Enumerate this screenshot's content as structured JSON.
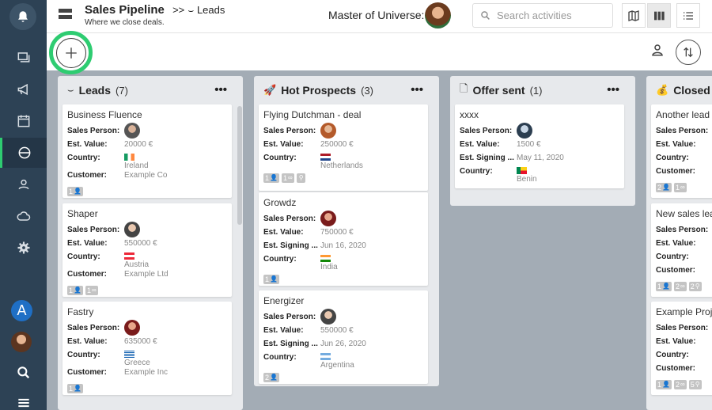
{
  "header": {
    "title": "Sales Pipeline",
    "breadcrumb_sep": ">>",
    "breadcrumb_current": "Leads",
    "subtitle": "Where we close deals.",
    "user_label": "Master of Universe:",
    "search_placeholder": "Search activities"
  },
  "sidebar": {
    "avatar_letter": "A"
  },
  "columns": [
    {
      "name": "Leads",
      "count": "(7)",
      "icon": "handshake-icon",
      "cards": [
        {
          "title": "Business Fluence",
          "rows": [
            {
              "label": "Sales Person:",
              "type": "avatar"
            },
            {
              "label": "Est. Value:",
              "value": "20000 €"
            },
            {
              "label": "Country:",
              "value": "Ireland",
              "flag": "ireland"
            },
            {
              "label": "Customer:",
              "value": "Example Co"
            }
          ],
          "badges": [
            "1"
          ]
        },
        {
          "title": "Shaper",
          "rows": [
            {
              "label": "Sales Person:",
              "type": "avatar"
            },
            {
              "label": "Est. Value:",
              "value": "550000 €"
            },
            {
              "label": "Country:",
              "value": "Austria",
              "flag": "austria"
            },
            {
              "label": "Customer:",
              "value": "Example Ltd"
            }
          ],
          "badges": [
            "1",
            "1"
          ]
        },
        {
          "title": "Fastry",
          "rows": [
            {
              "label": "Sales Person:",
              "type": "avatar"
            },
            {
              "label": "Est. Value:",
              "value": "635000 €"
            },
            {
              "label": "Country:",
              "value": "Greece",
              "flag": "greece"
            },
            {
              "label": "Customer:",
              "value": "Example Inc"
            }
          ],
          "badges": [
            "1"
          ]
        }
      ]
    },
    {
      "name": "Hot Prospects",
      "count": "(3)",
      "icon": "rocket-icon",
      "cards": [
        {
          "title": "Flying Dutchman - deal",
          "rows": [
            {
              "label": "Sales Person:",
              "type": "avatar"
            },
            {
              "label": "Est. Value:",
              "value": "250000 €"
            },
            {
              "label": "Country:",
              "value": "Netherlands",
              "flag": "netherlands"
            }
          ],
          "badges": [
            "1",
            "1",
            ""
          ]
        },
        {
          "title": "Growdz",
          "rows": [
            {
              "label": "Sales Person:",
              "type": "avatar"
            },
            {
              "label": "Est. Value:",
              "value": "750000 €"
            },
            {
              "label": "Est. Signing ...",
              "value": "Jun 16, 2020"
            },
            {
              "label": "Country:",
              "value": "India",
              "flag": "india"
            }
          ],
          "badges": [
            "1"
          ]
        },
        {
          "title": "Energizer",
          "rows": [
            {
              "label": "Sales Person:",
              "type": "avatar"
            },
            {
              "label": "Est. Value:",
              "value": "550000 €"
            },
            {
              "label": "Est. Signing ...",
              "value": "Jun 26, 2020"
            },
            {
              "label": "Country:",
              "value": "Argentina",
              "flag": "argentina"
            }
          ],
          "badges": [
            "2"
          ]
        }
      ]
    },
    {
      "name": "Offer sent",
      "count": "(1)",
      "icon": "document-icon",
      "cards": [
        {
          "title": "xxxx",
          "rows": [
            {
              "label": "Sales Person:",
              "type": "avatar"
            },
            {
              "label": "Est. Value:",
              "value": "1500 €"
            },
            {
              "label": "Est. Signing ...",
              "value": "May 11, 2020"
            },
            {
              "label": "Country:",
              "value": "Benin",
              "flag": "benin"
            }
          ],
          "badges": []
        }
      ]
    },
    {
      "name": "Closed D",
      "count": "",
      "icon": "money-bag-icon",
      "cards": [
        {
          "title": "Another lead",
          "rows": [
            {
              "label": "Sales Person:",
              "type": "blank"
            },
            {
              "label": "Est. Value:",
              "type": "blank"
            },
            {
              "label": "Country:",
              "type": "blank"
            },
            {
              "label": "Customer:",
              "type": "blank"
            }
          ],
          "badges": [
            "2",
            "1"
          ]
        },
        {
          "title": "New sales lea",
          "rows": [
            {
              "label": "Sales Person:",
              "type": "blank"
            },
            {
              "label": "Est. Value:",
              "type": "blank"
            },
            {
              "label": "Country:",
              "type": "blank"
            },
            {
              "label": "Customer:",
              "type": "blank"
            }
          ],
          "badges": [
            "1",
            "2",
            "2"
          ]
        },
        {
          "title": "Example Proj",
          "rows": [
            {
              "label": "Sales Person:",
              "type": "blank"
            },
            {
              "label": "Est. Value:",
              "type": "blank"
            },
            {
              "label": "Country:",
              "type": "blank"
            },
            {
              "label": "Customer:",
              "type": "blank"
            }
          ],
          "badges": [
            "1",
            "2",
            "5"
          ]
        }
      ]
    }
  ]
}
